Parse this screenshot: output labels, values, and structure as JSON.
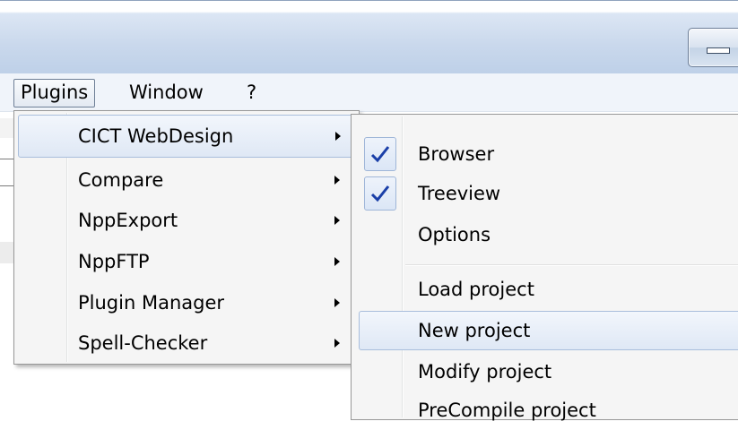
{
  "menubar": {
    "items": [
      "Plugins",
      "Window",
      "?"
    ]
  },
  "plugins_menu": {
    "items": [
      {
        "label": "CICT WebDesign",
        "has_submenu": true,
        "highlighted": true
      },
      {
        "label": "Compare",
        "has_submenu": true
      },
      {
        "label": "NppExport",
        "has_submenu": true
      },
      {
        "label": "NppFTP",
        "has_submenu": true
      },
      {
        "label": "Plugin Manager",
        "has_submenu": true
      },
      {
        "label": "Spell-Checker",
        "has_submenu": true
      }
    ]
  },
  "cict_submenu": {
    "items": [
      {
        "label": "Browser",
        "checked": true
      },
      {
        "label": "Treeview",
        "checked": true
      },
      {
        "label": "Options",
        "checked": false
      },
      {
        "label": "Load project",
        "checked": false
      },
      {
        "label": "New project",
        "checked": false,
        "highlighted": true
      },
      {
        "label": "Modify project",
        "checked": false
      },
      {
        "label": "PreCompile project",
        "checked": false
      }
    ]
  },
  "colors": {
    "check": "#1a3fa8",
    "highlight_border": "#a9bedc",
    "menu_background": "#f5f5f5"
  }
}
